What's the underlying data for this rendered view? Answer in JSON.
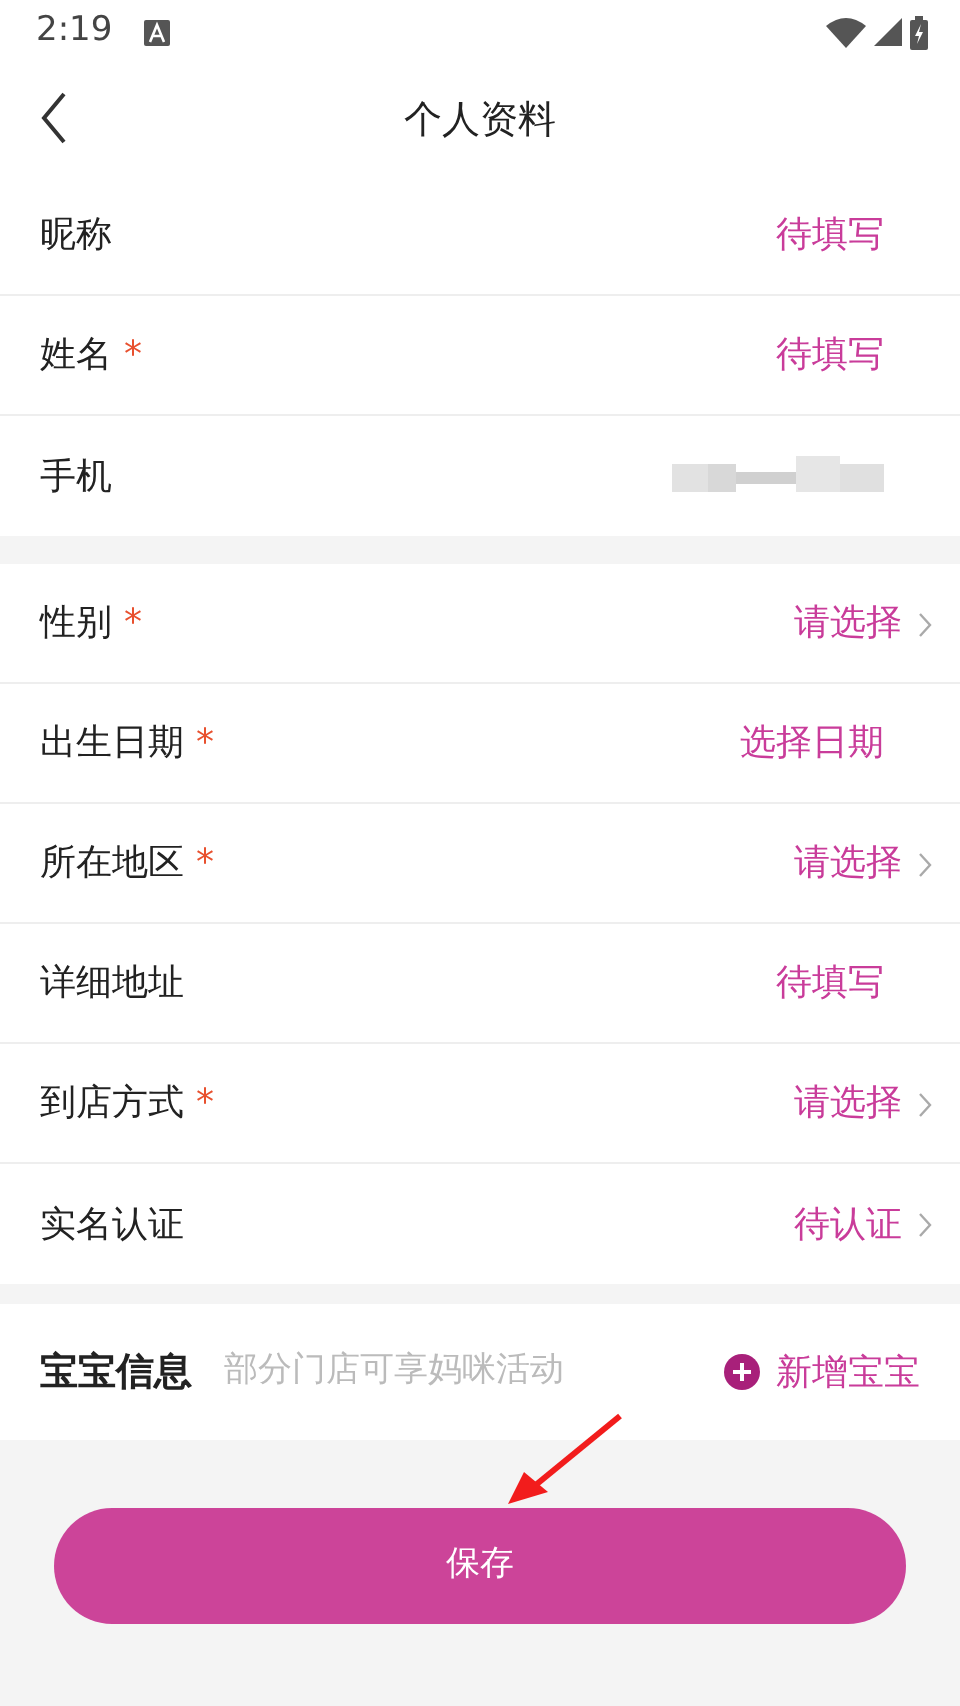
{
  "status_bar": {
    "time": "2:19"
  },
  "header": {
    "title": "个人资料"
  },
  "sections": [
    {
      "rows": [
        {
          "label": "昵称",
          "kind": "text",
          "value": "待填写",
          "chevron": false
        },
        {
          "label": "姓名",
          "required_mark": "*",
          "kind": "text",
          "value": "待填写",
          "chevron": false
        },
        {
          "label": "手机",
          "kind": "blurred",
          "chevron": false
        }
      ]
    },
    {
      "rows": [
        {
          "label": "性别",
          "required_mark": "*",
          "kind": "text",
          "value": "请选择",
          "chevron": true
        },
        {
          "label": "出生日期",
          "required_mark": "*",
          "kind": "text",
          "value": "选择日期",
          "chevron": false
        },
        {
          "label": "所在地区",
          "required_mark": "*",
          "kind": "text",
          "value": "请选择",
          "chevron": true
        },
        {
          "label": "详细地址",
          "kind": "text",
          "value": "待填写",
          "chevron": false
        },
        {
          "label": "到店方式",
          "required_mark": "*",
          "kind": "text",
          "value": "请选择",
          "chevron": true
        },
        {
          "label": "实名认证",
          "kind": "text",
          "value": "待认证",
          "chevron": true
        }
      ]
    }
  ],
  "baby": {
    "title": "宝宝信息",
    "hint": "部分门店可享妈咪活动",
    "add_label": "新增宝宝"
  },
  "save_button": "保存"
}
